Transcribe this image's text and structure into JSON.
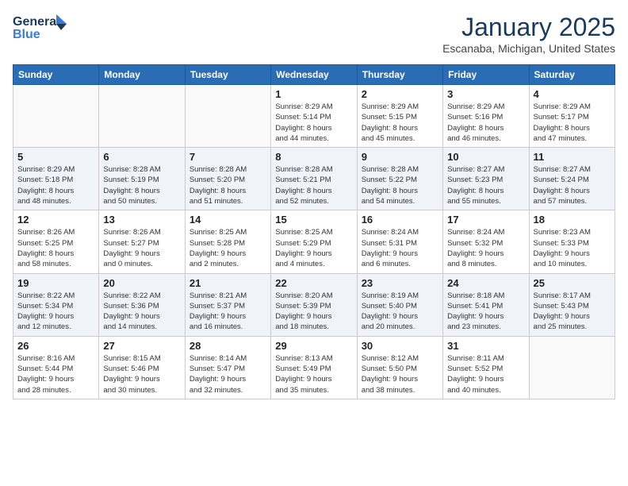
{
  "logo": {
    "line1": "General",
    "line2": "Blue"
  },
  "title": "January 2025",
  "subtitle": "Escanaba, Michigan, United States",
  "weekdays": [
    "Sunday",
    "Monday",
    "Tuesday",
    "Wednesday",
    "Thursday",
    "Friday",
    "Saturday"
  ],
  "weeks": [
    [
      {
        "day": "",
        "info": ""
      },
      {
        "day": "",
        "info": ""
      },
      {
        "day": "",
        "info": ""
      },
      {
        "day": "1",
        "info": "Sunrise: 8:29 AM\nSunset: 5:14 PM\nDaylight: 8 hours\nand 44 minutes."
      },
      {
        "day": "2",
        "info": "Sunrise: 8:29 AM\nSunset: 5:15 PM\nDaylight: 8 hours\nand 45 minutes."
      },
      {
        "day": "3",
        "info": "Sunrise: 8:29 AM\nSunset: 5:16 PM\nDaylight: 8 hours\nand 46 minutes."
      },
      {
        "day": "4",
        "info": "Sunrise: 8:29 AM\nSunset: 5:17 PM\nDaylight: 8 hours\nand 47 minutes."
      }
    ],
    [
      {
        "day": "5",
        "info": "Sunrise: 8:29 AM\nSunset: 5:18 PM\nDaylight: 8 hours\nand 48 minutes."
      },
      {
        "day": "6",
        "info": "Sunrise: 8:28 AM\nSunset: 5:19 PM\nDaylight: 8 hours\nand 50 minutes."
      },
      {
        "day": "7",
        "info": "Sunrise: 8:28 AM\nSunset: 5:20 PM\nDaylight: 8 hours\nand 51 minutes."
      },
      {
        "day": "8",
        "info": "Sunrise: 8:28 AM\nSunset: 5:21 PM\nDaylight: 8 hours\nand 52 minutes."
      },
      {
        "day": "9",
        "info": "Sunrise: 8:28 AM\nSunset: 5:22 PM\nDaylight: 8 hours\nand 54 minutes."
      },
      {
        "day": "10",
        "info": "Sunrise: 8:27 AM\nSunset: 5:23 PM\nDaylight: 8 hours\nand 55 minutes."
      },
      {
        "day": "11",
        "info": "Sunrise: 8:27 AM\nSunset: 5:24 PM\nDaylight: 8 hours\nand 57 minutes."
      }
    ],
    [
      {
        "day": "12",
        "info": "Sunrise: 8:26 AM\nSunset: 5:25 PM\nDaylight: 8 hours\nand 58 minutes."
      },
      {
        "day": "13",
        "info": "Sunrise: 8:26 AM\nSunset: 5:27 PM\nDaylight: 9 hours\nand 0 minutes."
      },
      {
        "day": "14",
        "info": "Sunrise: 8:25 AM\nSunset: 5:28 PM\nDaylight: 9 hours\nand 2 minutes."
      },
      {
        "day": "15",
        "info": "Sunrise: 8:25 AM\nSunset: 5:29 PM\nDaylight: 9 hours\nand 4 minutes."
      },
      {
        "day": "16",
        "info": "Sunrise: 8:24 AM\nSunset: 5:31 PM\nDaylight: 9 hours\nand 6 minutes."
      },
      {
        "day": "17",
        "info": "Sunrise: 8:24 AM\nSunset: 5:32 PM\nDaylight: 9 hours\nand 8 minutes."
      },
      {
        "day": "18",
        "info": "Sunrise: 8:23 AM\nSunset: 5:33 PM\nDaylight: 9 hours\nand 10 minutes."
      }
    ],
    [
      {
        "day": "19",
        "info": "Sunrise: 8:22 AM\nSunset: 5:34 PM\nDaylight: 9 hours\nand 12 minutes."
      },
      {
        "day": "20",
        "info": "Sunrise: 8:22 AM\nSunset: 5:36 PM\nDaylight: 9 hours\nand 14 minutes."
      },
      {
        "day": "21",
        "info": "Sunrise: 8:21 AM\nSunset: 5:37 PM\nDaylight: 9 hours\nand 16 minutes."
      },
      {
        "day": "22",
        "info": "Sunrise: 8:20 AM\nSunset: 5:39 PM\nDaylight: 9 hours\nand 18 minutes."
      },
      {
        "day": "23",
        "info": "Sunrise: 8:19 AM\nSunset: 5:40 PM\nDaylight: 9 hours\nand 20 minutes."
      },
      {
        "day": "24",
        "info": "Sunrise: 8:18 AM\nSunset: 5:41 PM\nDaylight: 9 hours\nand 23 minutes."
      },
      {
        "day": "25",
        "info": "Sunrise: 8:17 AM\nSunset: 5:43 PM\nDaylight: 9 hours\nand 25 minutes."
      }
    ],
    [
      {
        "day": "26",
        "info": "Sunrise: 8:16 AM\nSunset: 5:44 PM\nDaylight: 9 hours\nand 28 minutes."
      },
      {
        "day": "27",
        "info": "Sunrise: 8:15 AM\nSunset: 5:46 PM\nDaylight: 9 hours\nand 30 minutes."
      },
      {
        "day": "28",
        "info": "Sunrise: 8:14 AM\nSunset: 5:47 PM\nDaylight: 9 hours\nand 32 minutes."
      },
      {
        "day": "29",
        "info": "Sunrise: 8:13 AM\nSunset: 5:49 PM\nDaylight: 9 hours\nand 35 minutes."
      },
      {
        "day": "30",
        "info": "Sunrise: 8:12 AM\nSunset: 5:50 PM\nDaylight: 9 hours\nand 38 minutes."
      },
      {
        "day": "31",
        "info": "Sunrise: 8:11 AM\nSunset: 5:52 PM\nDaylight: 9 hours\nand 40 minutes."
      },
      {
        "day": "",
        "info": ""
      }
    ]
  ]
}
